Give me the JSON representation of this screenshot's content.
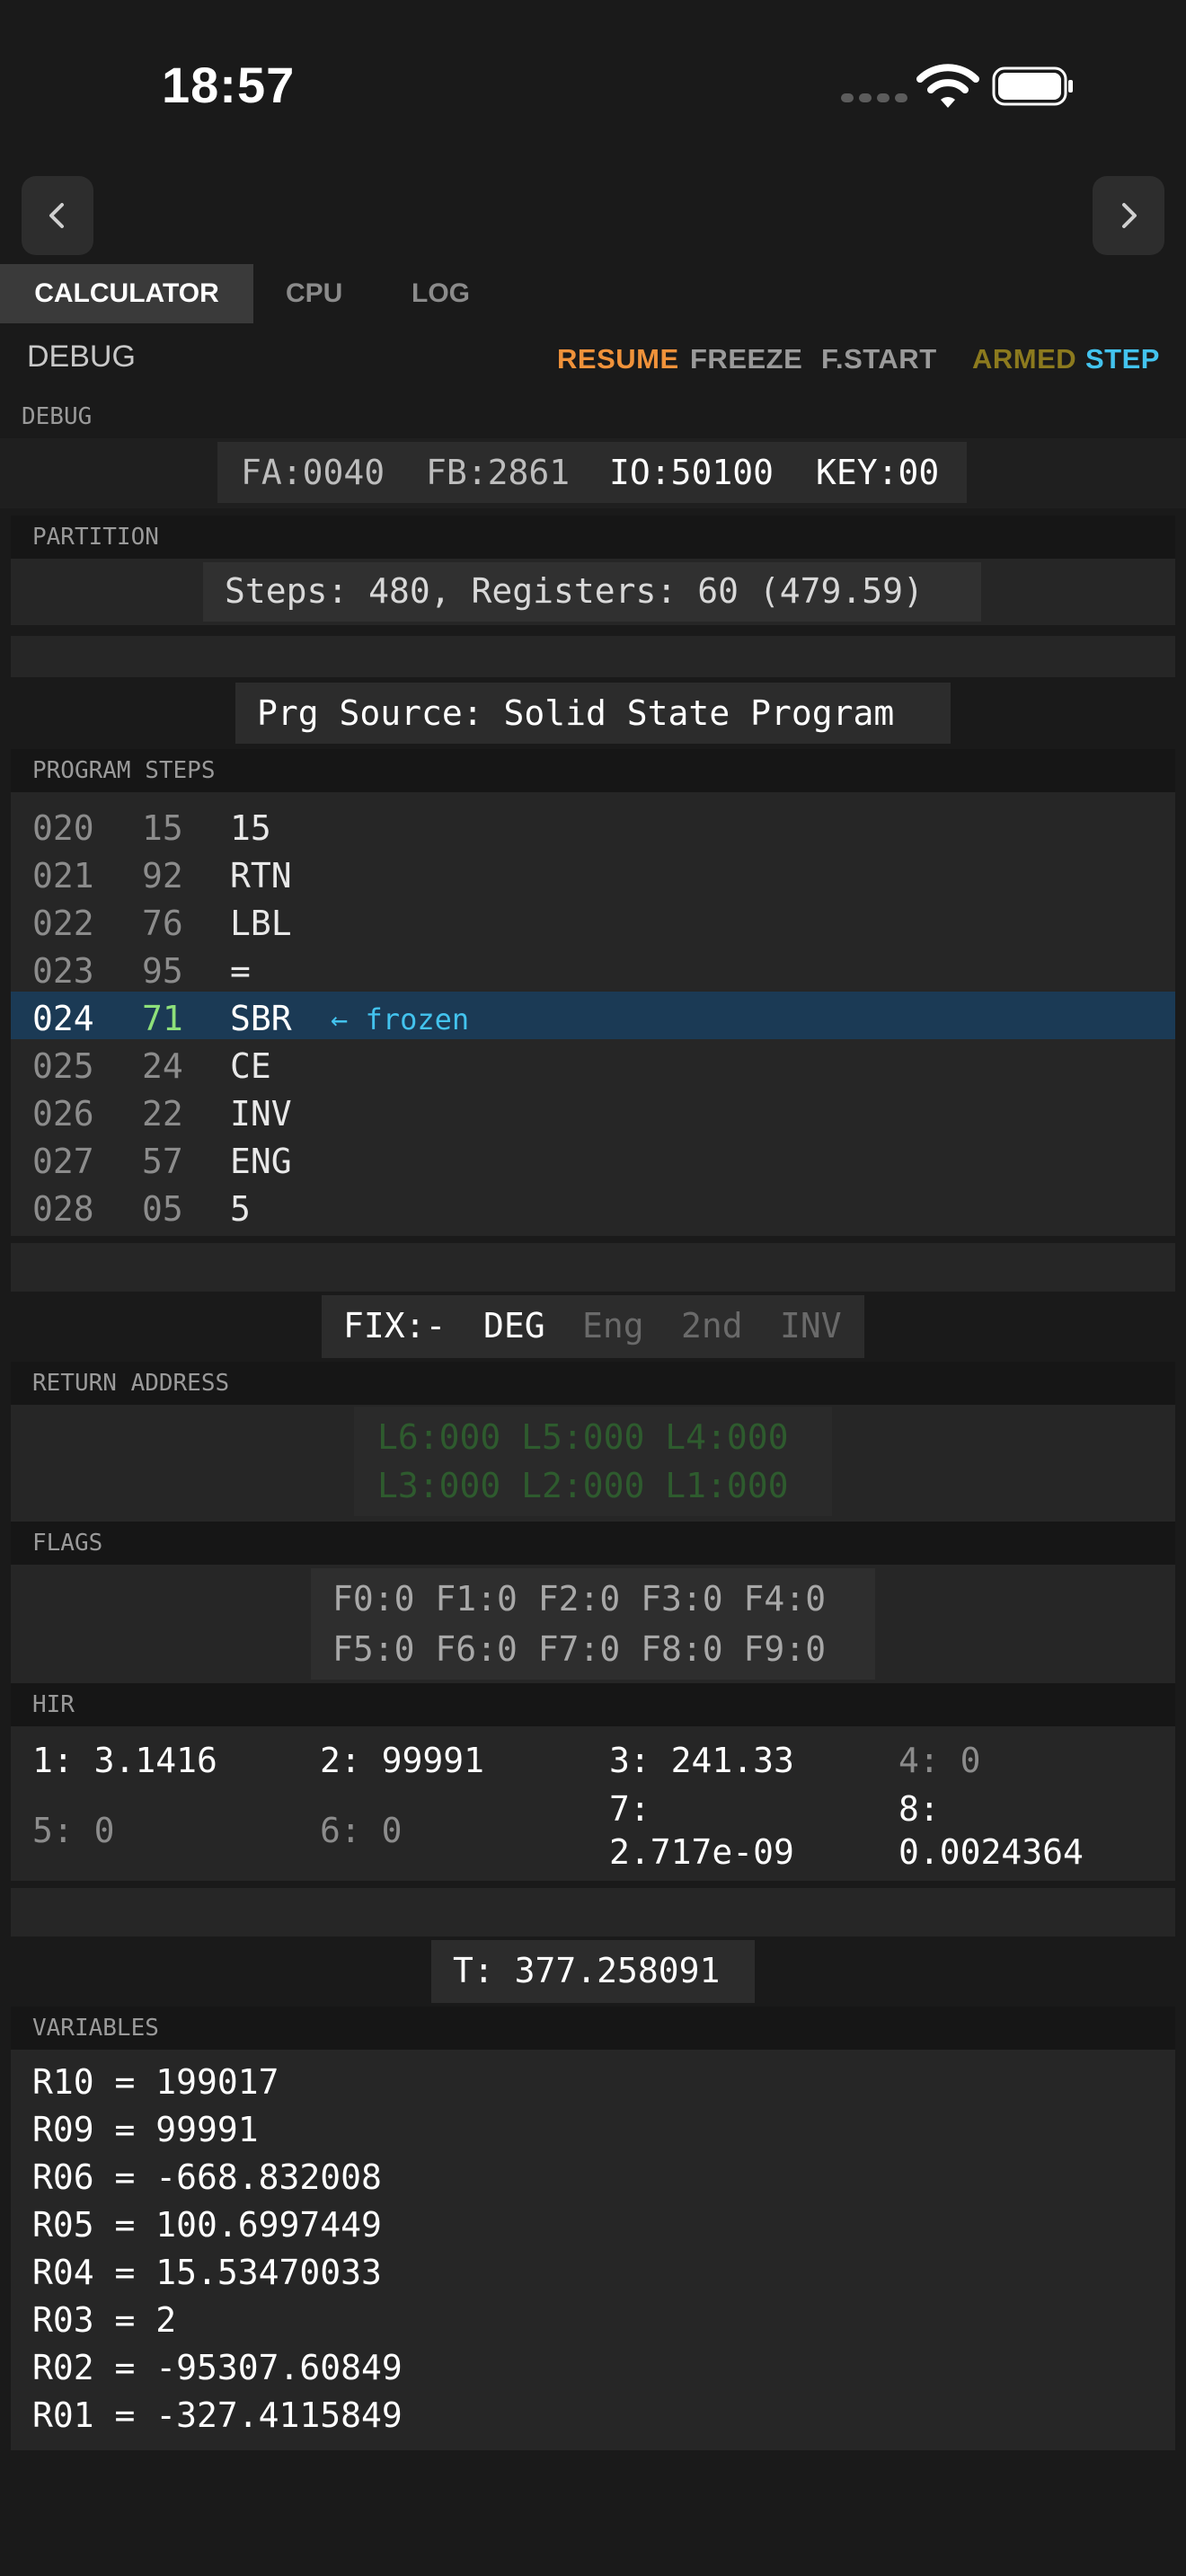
{
  "status_bar": {
    "time": "18:57"
  },
  "tabs": [
    "CALCULATOR",
    "CPU",
    "LOG"
  ],
  "debug": {
    "title": "DEBUG",
    "controls": {
      "resume": "RESUME",
      "freeze": "FREEZE",
      "fstart": "F.START",
      "armed": "ARMED",
      "step": "STEP"
    },
    "section_label": "DEBUG",
    "registers": {
      "fa": "FA:0040",
      "fb": "FB:2861",
      "io": "IO:50100",
      "key": "KEY:00"
    }
  },
  "partition": {
    "label": "PARTITION",
    "value": "Steps: 480, Registers: 60 (479.59)"
  },
  "source": {
    "value": "Prg Source: Solid State Program"
  },
  "program_steps": {
    "label": "PROGRAM STEPS",
    "rows": [
      {
        "addr": "020",
        "code": "15",
        "mnemonic": "15"
      },
      {
        "addr": "021",
        "code": "92",
        "mnemonic": "RTN"
      },
      {
        "addr": "022",
        "code": "76",
        "mnemonic": "LBL"
      },
      {
        "addr": "023",
        "code": "95",
        "mnemonic": "="
      },
      {
        "addr": "024",
        "code": "71",
        "mnemonic": "SBR",
        "note": "← frozen"
      },
      {
        "addr": "025",
        "code": "24",
        "mnemonic": "CE"
      },
      {
        "addr": "026",
        "code": "22",
        "mnemonic": "INV"
      },
      {
        "addr": "027",
        "code": "57",
        "mnemonic": "ENG"
      },
      {
        "addr": "028",
        "code": "05",
        "mnemonic": "5"
      }
    ]
  },
  "modes": {
    "fix": "FIX:-",
    "deg": "DEG",
    "eng": "Eng",
    "second": "2nd",
    "inv": "INV"
  },
  "return_address": {
    "label": "RETURN ADDRESS",
    "line1": "L6:000 L5:000 L4:000",
    "line2": "L3:000 L2:000 L1:000"
  },
  "flags": {
    "label": "FLAGS",
    "line1": "F0:0 F1:0 F2:0 F3:0 F4:0",
    "line2": "F5:0 F6:0 F7:0 F8:0 F9:0"
  },
  "hir": {
    "label": "HIR",
    "cells": [
      "1: 3.1416",
      "2: 99991",
      "3: 241.33",
      "4: 0",
      "5: 0",
      "6: 0",
      "7:",
      "2.717e-09",
      "8:",
      "0.0024364"
    ]
  },
  "t_register": {
    "value": "T: 377.258091"
  },
  "variables": {
    "label": "VARIABLES",
    "items": [
      "R10 = 199017",
      "R09 = 99991",
      "R06 = -668.832008",
      "R05 = 100.6997449",
      "R04 = 15.53470033",
      "R03 = 2",
      "R02 = -95307.60849",
      "R01 = -327.4115849"
    ]
  },
  "colors": {
    "resume": "#f0923a",
    "freeze": "#9a9a9a",
    "armed": "#8c7a1e",
    "step": "#43c3ee",
    "current_row": "#1b3a55",
    "current_code": "#8ee07a",
    "frozen_note": "#43c3ee",
    "return_address_text": "#2e5b2e"
  },
  "icons": {
    "back": "chevron-left-icon",
    "forward": "chevron-right-icon",
    "wifi": "wifi-icon",
    "battery": "battery-icon"
  }
}
